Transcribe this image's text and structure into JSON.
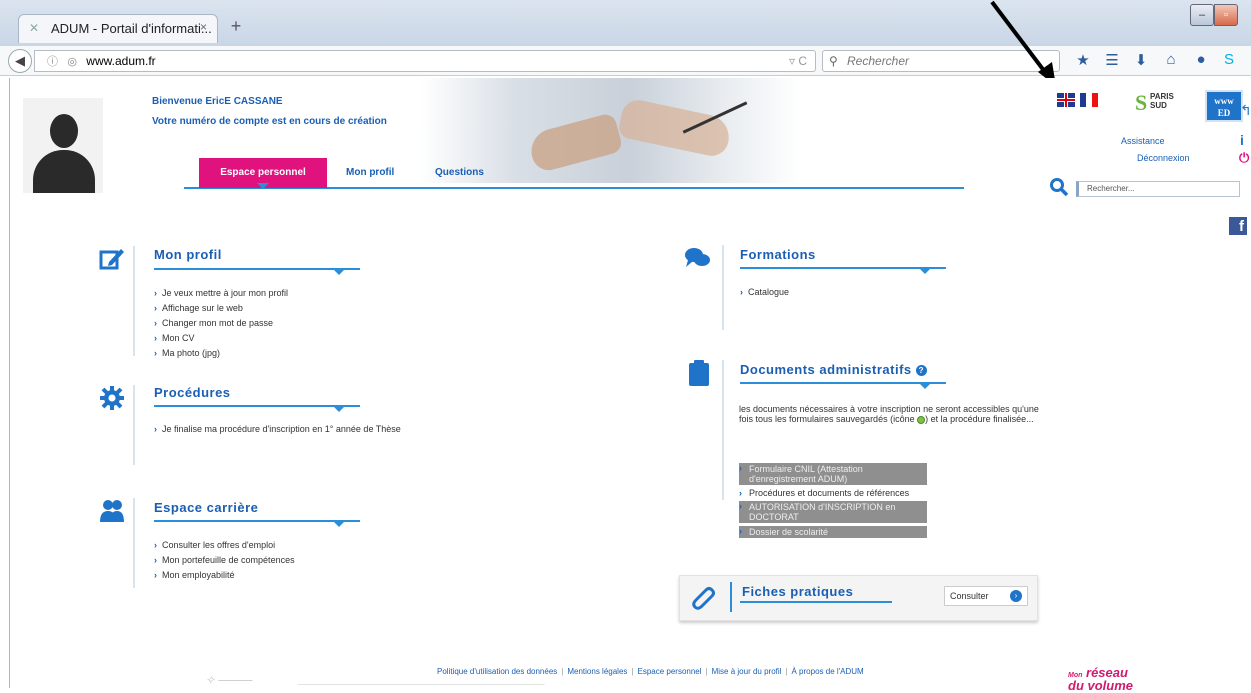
{
  "browser": {
    "tab_title": "ADUM - Portail d'informati...",
    "tab_close": "×",
    "new_tab": "+",
    "url": "www.adum.fr",
    "search_placeholder": "Rechercher"
  },
  "header": {
    "welcome": "Bienvenue EricE CASSANE",
    "account_status": "Votre numéro de compte est en cours de création",
    "tabs": [
      "Espace personnel",
      "Mon profil",
      "Questions"
    ],
    "logo_ps": "PARIS SUD",
    "logo_ed": "www ED",
    "assistance": "Assistance",
    "logout": "Déconnexion",
    "search_placeholder": "Rechercher...",
    "facebook": "f"
  },
  "sections": {
    "mon_profil": {
      "title": "Mon profil",
      "items": [
        "Je veux mettre à jour mon profil",
        "Affichage sur le web",
        "Changer mon mot de passe",
        "Mon CV",
        "Ma photo (jpg)"
      ]
    },
    "procedures": {
      "title": "Procédures",
      "items": [
        "Je finalise ma procédure d'inscription en 1° année de Thèse"
      ]
    },
    "carriere": {
      "title": "Espace carrière",
      "items": [
        "Consulter les offres d'emploi",
        "Mon portefeuille de compétences",
        "Mon employabilité"
      ]
    },
    "formations": {
      "title": "Formations",
      "items": [
        "Catalogue"
      ]
    },
    "documents": {
      "title": "Documents administratifs",
      "text_before": "les documents nécessaires à votre inscription ne seront accessibles qu'une fois tous les formulaires sauvegardés (icône ",
      "text_after": ") et la procédure finalisée...",
      "links": [
        "Formulaire CNIL (Attestation d'enregistrement ADUM)",
        "Procédures et documents de références",
        "AUTORISATION d'INSCRIPTION en DOCTORAT",
        "Dossier de scolarité"
      ]
    },
    "fiches": {
      "title": "Fiches pratiques",
      "button": "Consulter"
    }
  },
  "footer": {
    "links": [
      "Politique d'utilisation des données",
      "Mentions légales",
      "Espace personnel",
      "Mise à jour du profil",
      "À propos de l'ADUM"
    ],
    "logo_right_small": "Mon",
    "logo_right_line1": "réseau",
    "logo_right_line2": "du volume"
  },
  "colors": {
    "brand_blue": "#1a5fb4",
    "accent_pink": "#e0127e",
    "line_blue": "#2a8fd8"
  }
}
